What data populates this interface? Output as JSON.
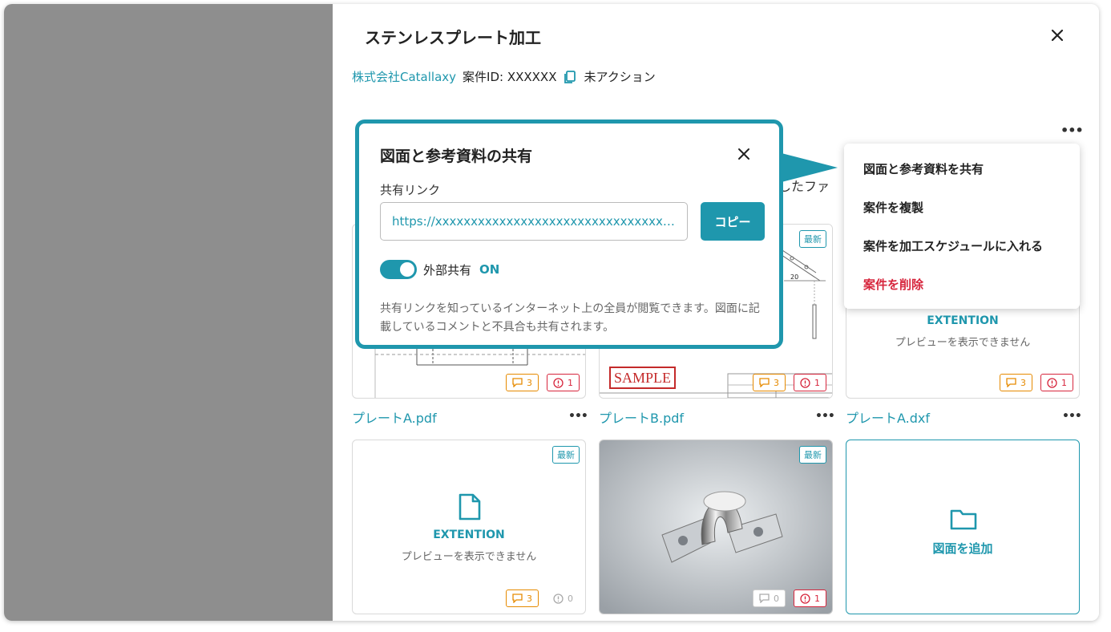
{
  "panel": {
    "title": "ステンレスプレート加工",
    "company": "株式会社Catallaxy",
    "case_id": "案件ID: XXXXXX",
    "status": "未アクション"
  },
  "menu": {
    "items": [
      {
        "label": "図面と参考資料を共有"
      },
      {
        "label": "案件を複製"
      },
      {
        "label": "案件を加工スケジュールに入れる"
      },
      {
        "label": "案件を削除"
      }
    ]
  },
  "share_dialog": {
    "title": "図面と参考資料の共有",
    "link_label": "共有リンク",
    "link_value": "https://xxxxxxxxxxxxxxxxxxxxxxxxxxxxxxxxxxxxxxxx",
    "copy_label": "コピー",
    "toggle_label": "外部共有",
    "toggle_state": "ON",
    "description": "共有リンクを知っているインターネット上の全員が閲覧できます。図面に記載しているコメントと不具合も共有されます。"
  },
  "hidden_text_fragment": "したファ",
  "files": [
    {
      "name": "プレートA.pdf",
      "comments": "3",
      "issues": "1"
    },
    {
      "name": "プレートB.pdf",
      "badge": "最新",
      "sample": "SAMPLE",
      "dim": "20",
      "comments": "3",
      "issues": "1"
    },
    {
      "name": "プレートA.dxf",
      "ext": "EXTENTION",
      "preview_msg": "プレビューを表示できません",
      "comments": "3",
      "issues": "1"
    },
    {
      "badge": "最新",
      "ext": "EXTENTION",
      "preview_msg": "プレビューを表示できません",
      "comments": "3",
      "issues": "0"
    },
    {
      "badge": "最新",
      "comments": "0",
      "issues": "1"
    }
  ],
  "add_card": {
    "label": "図面を追加"
  },
  "colors": {
    "accent": "#1f97ad",
    "warning": "#e68a00",
    "danger": "#d7263d"
  }
}
